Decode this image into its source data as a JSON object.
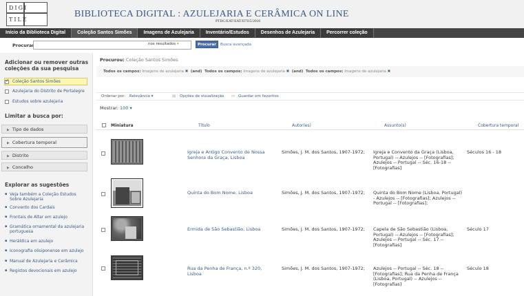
{
  "header": {
    "logo_line1": "DIGI",
    "logo_line2": "TILE",
    "title": "BIBLIOTECA DIGITAL : AZULEJARIA E CERÂMICA ON LINE",
    "subtitle": "PTDC/EAT/EAT/II7I15/2010"
  },
  "nav": [
    "Início da Biblioteca Digital",
    "Coleção Santos Simões",
    "Imagens de Azulejaria",
    "Inventário/Estudos",
    "Desenhos de Azulejaria",
    "Percorrer coleção"
  ],
  "search": {
    "label": "Procurar",
    "select": "nos resultados",
    "button": "Procurar",
    "advanced": "Busca avançada"
  },
  "sidebar": {
    "add_heading": "Adicionar ou remover outras coleções da sua pesquisa",
    "collections": [
      {
        "label": "Coleção Santos Simões",
        "checked": true
      },
      {
        "label": "Azulejaria do Distrito de Portalegre",
        "checked": false
      },
      {
        "label": "Estudos sobre azulejaria",
        "checked": false
      }
    ],
    "limit_heading": "Limitar a busca por:",
    "facets": [
      "Tipo de dados",
      "Cobertura temporal",
      "Distrito",
      "Concelho"
    ],
    "suggest_heading": "Explorar as sugestões",
    "suggestions": [
      "Veja também a Coleção Estudos Sobre Azulejaria",
      "Convento dos Cardais",
      "Frontais de Altar em azulejo",
      "Gramática ornamental da azulejaria portuguesa",
      "Heráldica em azulejo",
      "Iconografia olisiponense em azulejo",
      "Manual de Azulejaria e Cerâmica",
      "Registos devocionais em azulejo"
    ]
  },
  "main": {
    "procurou_label": "Procurou:",
    "procurou_value": "Coleção Santos Simões",
    "filter_field": "Todos os campos:",
    "filter_value": "Imagens de azulejaria",
    "filter_and": "(and)",
    "filter_x": "✖",
    "order_label": "Ordenar por:",
    "order_value": "Relevância ▾",
    "view_options": "Opções de visualização",
    "save_favorites": "Guardar em favoritos",
    "show_label": "Mostrar:",
    "show_value": "100 ▾",
    "columns": {
      "thumb": "Miniatura",
      "title": "Título",
      "author": "Autor(es)",
      "subject": "Assunto(s)",
      "coverage": "Cobertura temporal"
    },
    "rows": [
      {
        "title": "Igreja e Antigo Convento de Nossa Senhora da Graça, Lisboa",
        "author": "Simões, J. M. dos Santos, 1907-1972;",
        "subject": "Igreja e Convento da Graça (Lisboa, Portugal) -- Azulejos -- [Fotografias]; Azulejos -- Portugal -- Séc. 16-18 -- [Fotografias]",
        "coverage": "Séculos 16 - 18"
      },
      {
        "title": "Quinta do Bom Nome, Lisboa",
        "author": "Simões, J. M. dos Santos, 1907-1972;",
        "subject": "Quinta do Bom Nome (Lisboa, Portugal) - Azulejos -- [Fotografias]; Azulejos -- Portugal -- [Fotografias];",
        "coverage": ""
      },
      {
        "title": "Ermida de São Sebastião, Lisboa",
        "author": "Simões, J. M. dos Santos, 1907-1972;",
        "subject": "Capela de São Sebastião (Lisboa, Portugal) -- Azulejos -- [Fotografias]; Azulejos -- Portugal -- Séc. 17 -- [Fotografias]",
        "coverage": "Século 17"
      },
      {
        "title": "Rua da Penha de França, n.º 320, Lisboa",
        "author": "Simões, J. M. dos Santos, 1907-1972;",
        "subject": "Azulejos -- Portugal -- Séc. 18 -- [Fotografias]; Rua da Penha de França (Lisboa, Portugal) -- Azulejos -- [Fotografias]",
        "coverage": "Século 18"
      }
    ]
  }
}
